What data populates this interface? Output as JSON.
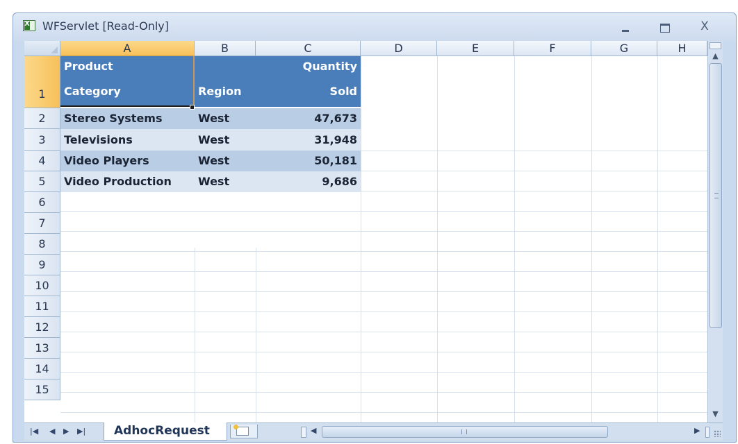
{
  "window": {
    "title": "WFServlet  [Read-Only]",
    "close_glyph": "X"
  },
  "columns": [
    "A",
    "B",
    "C",
    "D",
    "E",
    "F",
    "G",
    "H"
  ],
  "rows": [
    "1",
    "2",
    "3",
    "4",
    "5",
    "6",
    "7",
    "8",
    "9",
    "10",
    "11",
    "12",
    "13",
    "14",
    "15"
  ],
  "header": {
    "a_line1": "Product",
    "a_line2": "Category",
    "b_line2": "Region",
    "c_line1": "Quantity",
    "c_line2": "Sold"
  },
  "data_rows": [
    {
      "category": "Stereo Systems",
      "region": "West",
      "quantity": "47,673"
    },
    {
      "category": "Televisions",
      "region": "West",
      "quantity": "31,948"
    },
    {
      "category": "Video Players",
      "region": "West",
      "quantity": "50,181"
    },
    {
      "category": "Video Production",
      "region": "West",
      "quantity": "9,686"
    }
  ],
  "selection": {
    "cell": "A1"
  },
  "tabs": {
    "active": "AdhocRequest",
    "nav": [
      "|◀",
      "◀",
      "▶",
      "▶|"
    ]
  },
  "colors": {
    "header_fill": "#4a7ebb",
    "band_dark": "#b9cde5",
    "band_light": "#dce6f2",
    "selected_heading": "#f8c05a"
  }
}
